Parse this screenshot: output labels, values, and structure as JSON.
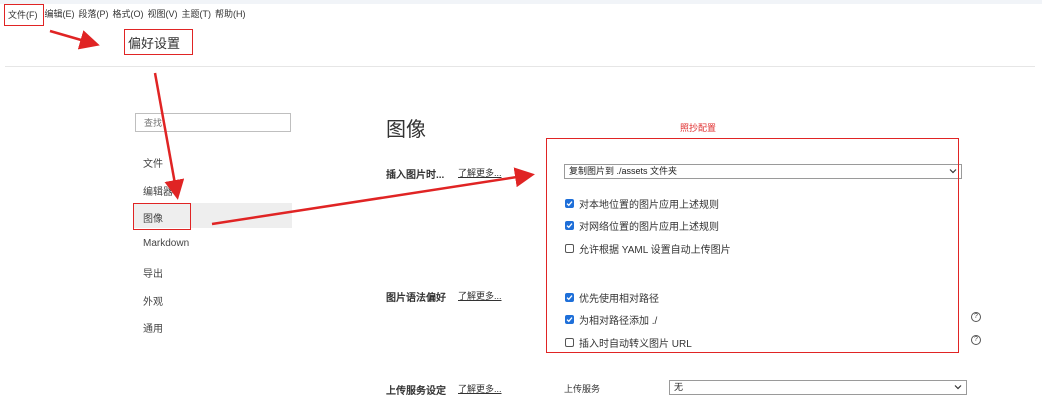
{
  "menu": {
    "items": [
      "文件(F)",
      "编辑(E)",
      "段落(P)",
      "格式(O)",
      "视图(V)",
      "主题(T)",
      "帮助(H)"
    ]
  },
  "preferences_label": "偏好设置",
  "sidebar": {
    "search_placeholder": "查找",
    "items": [
      "文件",
      "编辑器",
      "图像",
      "Markdown",
      "导出",
      "外观",
      "通用"
    ],
    "active": "图像"
  },
  "main": {
    "section_title": "图像",
    "annotation_note": "照抄配置",
    "insert_image": {
      "label": "插入图片时...",
      "learn_more": "了解更多...",
      "select_value": "复制图片到 ./assets 文件夹",
      "options": [
        {
          "label": "对本地位置的图片应用上述规则",
          "checked": true
        },
        {
          "label": "对网络位置的图片应用上述规则",
          "checked": true
        },
        {
          "label": "允许根据 YAML 设置自动上传图片",
          "checked": false
        }
      ]
    },
    "syntax_pref": {
      "label": "图片语法偏好",
      "learn_more": "了解更多...",
      "options": [
        {
          "label": "优先使用相对路径",
          "checked": true
        },
        {
          "label": "为相对路径添加 ./",
          "checked": true
        },
        {
          "label": "插入时自动转义图片 URL",
          "checked": false
        }
      ]
    },
    "upload": {
      "label": "上传服务设定",
      "learn_more": "了解更多...",
      "service_label": "上传服务",
      "service_value": "无"
    }
  },
  "colors": {
    "accent": "#1e6fd9",
    "annotation": "#e02424"
  }
}
